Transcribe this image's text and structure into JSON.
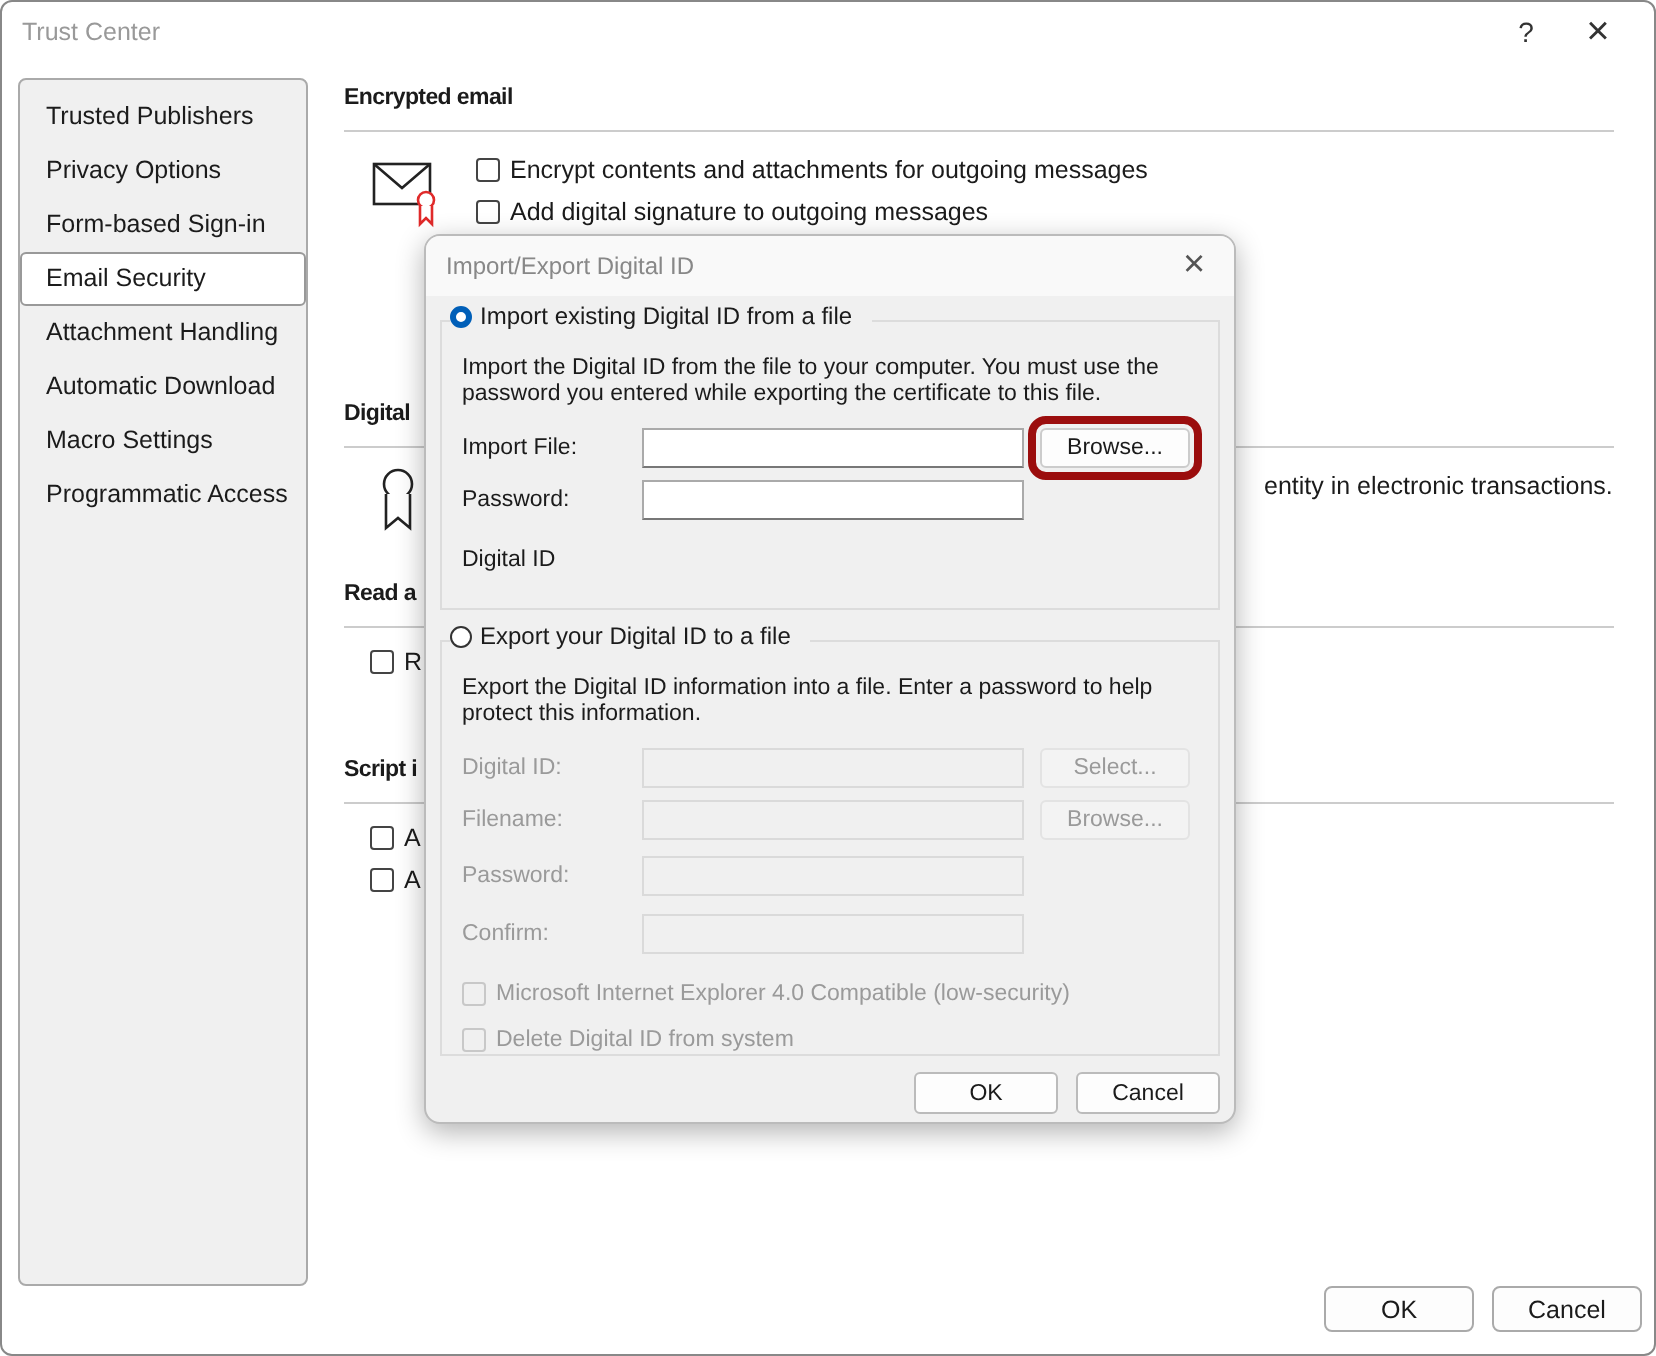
{
  "window": {
    "title": "Trust Center",
    "help": "?",
    "close": "×"
  },
  "sidebar": {
    "items": [
      {
        "label": "Trusted Publishers",
        "selected": false
      },
      {
        "label": "Privacy Options",
        "selected": false
      },
      {
        "label": "Form-based Sign-in",
        "selected": false
      },
      {
        "label": "Email Security",
        "selected": true
      },
      {
        "label": "Attachment Handling",
        "selected": false
      },
      {
        "label": "Automatic Download",
        "selected": false
      },
      {
        "label": "Macro Settings",
        "selected": false
      },
      {
        "label": "Programmatic Access",
        "selected": false
      }
    ]
  },
  "sections": [
    {
      "kind": "mail",
      "heading": "Encrypted email",
      "options": [
        {
          "label": "Encrypt contents and attachments for outgoing messages",
          "checked": false
        },
        {
          "label": "Add digital signature to outgoing messages",
          "checked": false
        }
      ]
    },
    {
      "kind": "certificate",
      "heading": "Digital",
      "text": "entity in electronic transactions."
    },
    {
      "kind": "plain",
      "heading": "Read a",
      "options": [
        {
          "label": "R",
          "checked": false
        }
      ]
    },
    {
      "kind": "plain",
      "heading": "Script i",
      "options": [
        {
          "label": "A",
          "checked": false
        },
        {
          "label": "A",
          "checked": false
        }
      ]
    }
  ],
  "buttons": [
    "OK",
    "Cancel"
  ],
  "dialog": {
    "title": "Import/Export Digital ID",
    "close": "×",
    "groups": [
      {
        "label": "Import existing Digital ID from a file",
        "selected": true,
        "disabled": false,
        "description": "Import the Digital ID from the file to your computer. You must use the password you entered while exporting the certificate to this file.",
        "fields": [
          {
            "kind": "input",
            "label": "Import File:",
            "button": "Browse...",
            "highlighted": true
          },
          {
            "kind": "input",
            "label": "Password:"
          },
          {
            "kind": "text",
            "label": "Digital ID"
          }
        ]
      },
      {
        "label": "Export your Digital ID to a file",
        "selected": false,
        "disabled": true,
        "description": "Export the Digital ID information into a file. Enter a password to help protect this information.",
        "fields": [
          {
            "kind": "input",
            "label": "Digital ID:",
            "button": "Select..."
          },
          {
            "kind": "input",
            "label": "Filename:",
            "button": "Browse..."
          },
          {
            "kind": "input",
            "label": "Password:"
          },
          {
            "kind": "input",
            "label": "Confirm:"
          }
        ],
        "options": [
          {
            "label": "Microsoft Internet Explorer 4.0 Compatible (low-security)",
            "checked": false
          },
          {
            "label": "Delete Digital ID from system",
            "checked": false
          }
        ]
      }
    ],
    "buttons": [
      "OK",
      "Cancel"
    ]
  }
}
